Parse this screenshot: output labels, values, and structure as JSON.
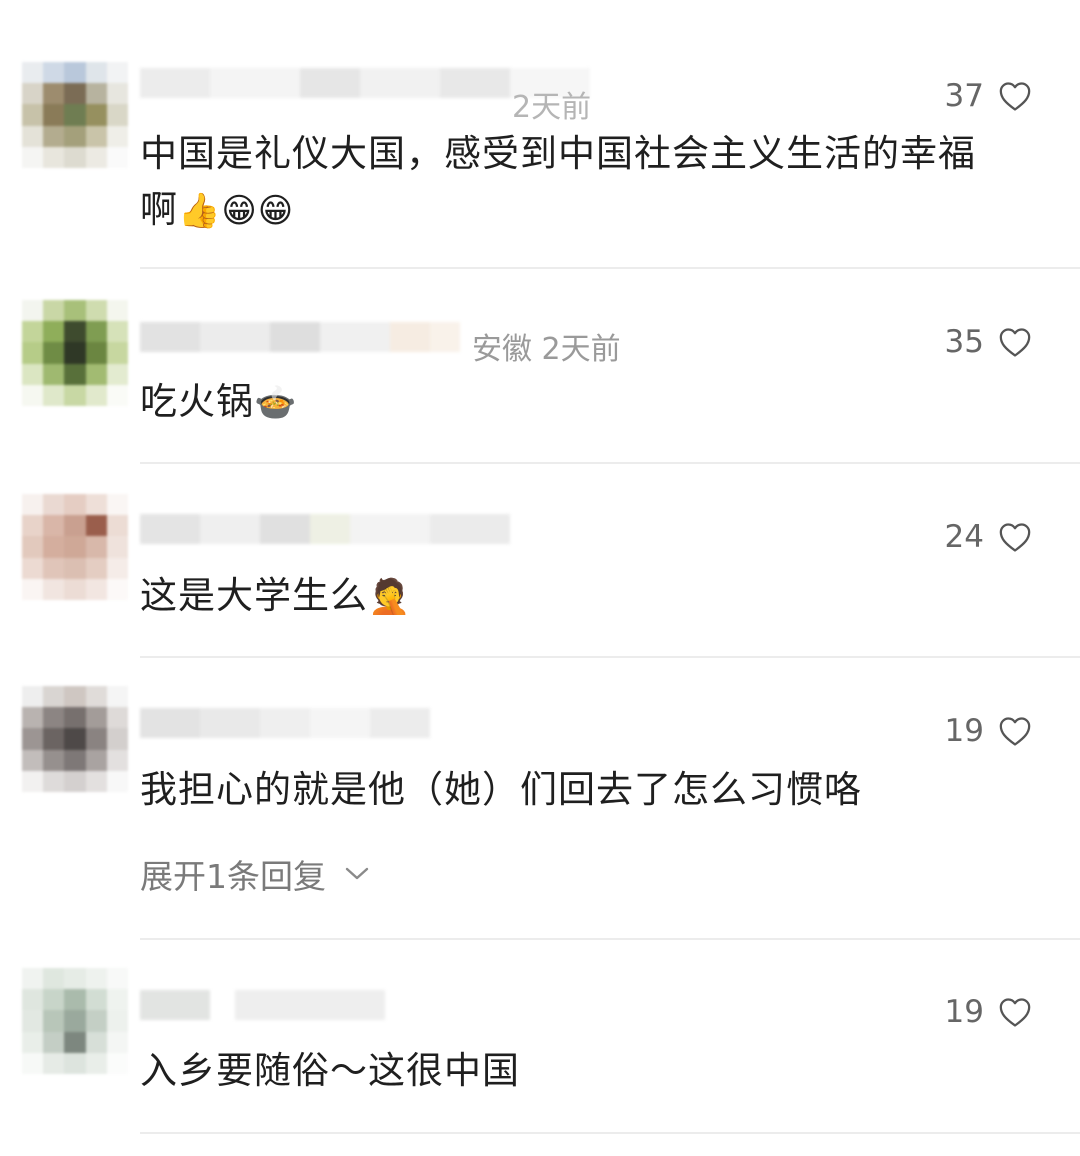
{
  "comments": [
    {
      "location_time": "2天前",
      "likes": "37",
      "text_line1": "中国是礼仪大国，感受到中国社会主义生活的幸福",
      "text_line2": "啊",
      "emojis": "👍😁😁"
    },
    {
      "location_time": "安徽 2天前",
      "likes": "35",
      "text": "吃火锅",
      "emoji": "🍲"
    },
    {
      "location_time": "",
      "likes": "24",
      "text": "这是大学生么",
      "emoji": "🤦"
    },
    {
      "location_time": "",
      "likes": "19",
      "text": "我担心的就是他（她）们回去了怎么习惯咯",
      "expand_label": "展开1条回复"
    },
    {
      "location_time": "",
      "likes": "19",
      "text": "入乡要随俗～这很中国"
    }
  ],
  "icons": {
    "like": "heart-outline-icon",
    "expand": "chevron-down-icon"
  },
  "colors": {
    "text": "#1f1f1f",
    "meta": "#9a9a9a",
    "divider": "#ececec"
  }
}
